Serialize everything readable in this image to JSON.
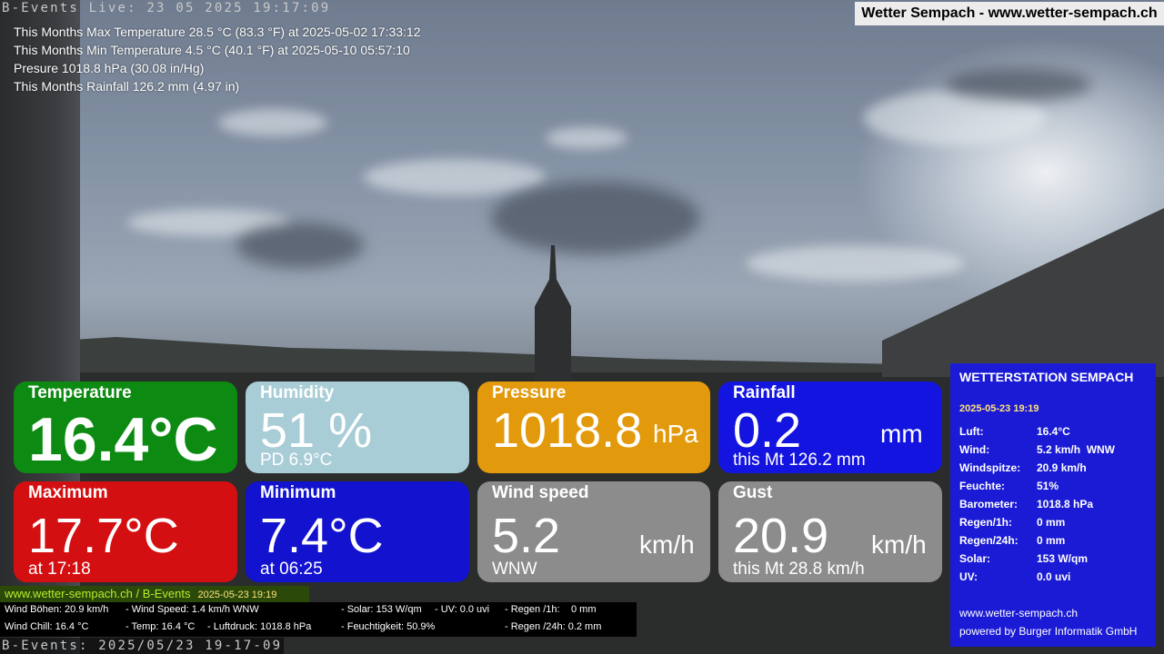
{
  "header": {
    "live_caption": "B-Events Live: 23 05 2025 19:17:09",
    "site_title": "Wetter Sempach - www.wetter-sempach.ch"
  },
  "stats": [
    "This Months Max Temperature 28.5 °C (83.3 °F) at 2025-05-02 17:33:12",
    "This Months Min Temperature 4.5 °C (40.1 °F) at 2025-05-10 05:57:10",
    "Presure 1018.8 hPa (30.08 in/Hg)",
    "This Months Rainfall 126.2 mm (4.97 in)"
  ],
  "tiles": {
    "temperature": {
      "title": "Temperature",
      "value": "16.4°C",
      "color": "#0d8a12"
    },
    "humidity": {
      "title": "Humidity",
      "value": "51 %",
      "sub": "PD 6.9°C",
      "color": "#a9cdd6"
    },
    "pressure": {
      "title": "Pressure",
      "value": "1018.8",
      "unit": "hPa",
      "color": "#e29a0c"
    },
    "rainfall": {
      "title": "Rainfall",
      "value": "0.2",
      "unit": "mm",
      "sub": "this Mt 126.2 mm",
      "color": "#1414e0"
    },
    "maximum": {
      "title": "Maximum",
      "value": "17.7°C",
      "sub": "at 17:18",
      "color": "#d40f12"
    },
    "minimum": {
      "title": "Minimum",
      "value": "7.4°C",
      "sub": "at 06:25",
      "color": "#1212cf"
    },
    "wind_speed": {
      "title": "Wind speed",
      "value": "5.2",
      "unit": "km/h",
      "sub": "WNW",
      "color": "#8c8c8c"
    },
    "gust": {
      "title": "Gust",
      "value": "20.9",
      "unit": "km/h",
      "sub": "this Mt 28.8 km/h",
      "color": "#8c8c8c"
    }
  },
  "station": {
    "title": "WETTERSTATION SEMPACH",
    "datetime": "2025-05-23 19:19",
    "rows": [
      {
        "k": "Luft:",
        "v": "16.4°C"
      },
      {
        "k": "Wind:",
        "v": "5.2 km/h  WNW"
      },
      {
        "k": "Windspitze:",
        "v": "20.9 km/h"
      },
      {
        "k": "Feuchte:",
        "v": "51%"
      },
      {
        "k": "Barometer:",
        "v": "1018.8 hPa"
      },
      {
        "k": "Regen/1h:",
        "v": "0 mm"
      },
      {
        "k": "Regen/24h:",
        "v": "0 mm"
      },
      {
        "k": "Solar:",
        "v": "153 W/qm"
      },
      {
        "k": "UV:",
        "v": "0.0 uvi"
      }
    ],
    "footer_url": "www.wetter-sempach.ch",
    "footer_powered": "powered by Burger Informatik GmbH"
  },
  "ticker": {
    "label": "www.wetter-sempach.ch / B-Events",
    "date": "2025-05-23 19:19"
  },
  "info_strip": {
    "wind_gusts": "Wind Böhen: 20.9 km/h",
    "wind_speed": "- Wind Speed: 1.4 km/h WNW",
    "solar": "- Solar: 153 W/qm",
    "uv": "- UV: 0.0 uvi",
    "rain_1h": "- Regen /1h:",
    "rain_1h_val": "0 mm",
    "wind_chill": "Wind Chill: 16.4 °C",
    "temp": "- Temp: 16.4 °C",
    "pressure": "- Luftdruck: 1018.8 hPa",
    "humidity": "- Feuchtigkeit: 50.9%",
    "rain_24h": "- Regen /24h: 0.2 mm"
  },
  "footer": {
    "caption": "B-Events: 2025/05/23 19-17-09"
  }
}
